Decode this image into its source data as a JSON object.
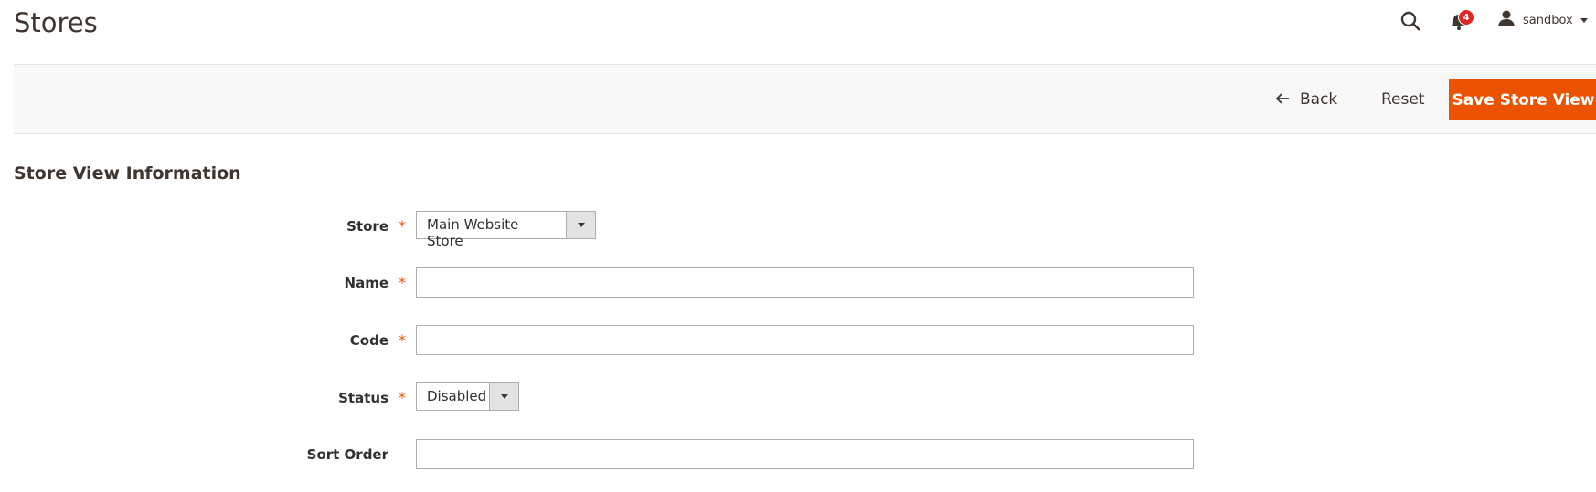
{
  "header": {
    "title": "Stores",
    "notifications_count": "4",
    "username": "sandbox",
    "icons": {
      "search": "search-icon",
      "bell": "bell-icon",
      "user": "user-icon"
    }
  },
  "page_actions": {
    "back_label": "Back",
    "reset_label": "Reset",
    "save_label": "Save Store View"
  },
  "section": {
    "title": "Store View Information"
  },
  "form": {
    "store": {
      "label": "Store",
      "required": true,
      "value": "Main Website Store"
    },
    "name": {
      "label": "Name",
      "required": true,
      "value": ""
    },
    "code": {
      "label": "Code",
      "required": true,
      "value": ""
    },
    "status": {
      "label": "Status",
      "required": true,
      "value": "Disabled"
    },
    "sort_order": {
      "label": "Sort Order",
      "required": false,
      "value": ""
    }
  },
  "colors": {
    "accent": "#eb5202",
    "badge": "#e22626"
  }
}
